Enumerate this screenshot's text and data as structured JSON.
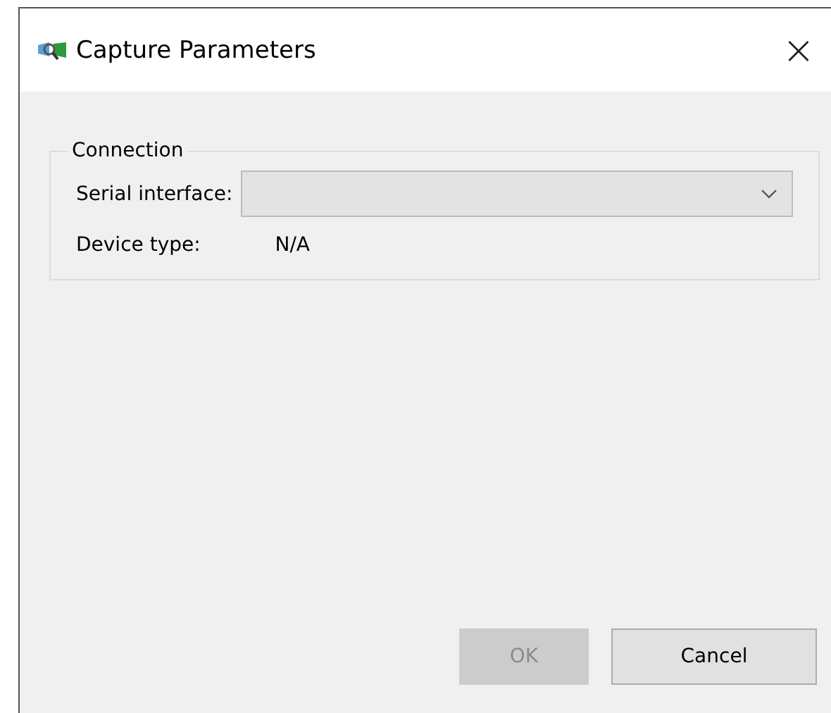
{
  "window": {
    "title": "Capture Parameters",
    "close": "×"
  },
  "group": {
    "title": "Connection",
    "serial_interface": {
      "label": "Serial interface:",
      "disabled": true
    },
    "device_type": {
      "label": "Device type:",
      "value": "N/A"
    }
  },
  "buttons": [
    {
      "label": "OK",
      "disabled": true
    },
    {
      "label": "Cancel",
      "disabled": false
    }
  ]
}
